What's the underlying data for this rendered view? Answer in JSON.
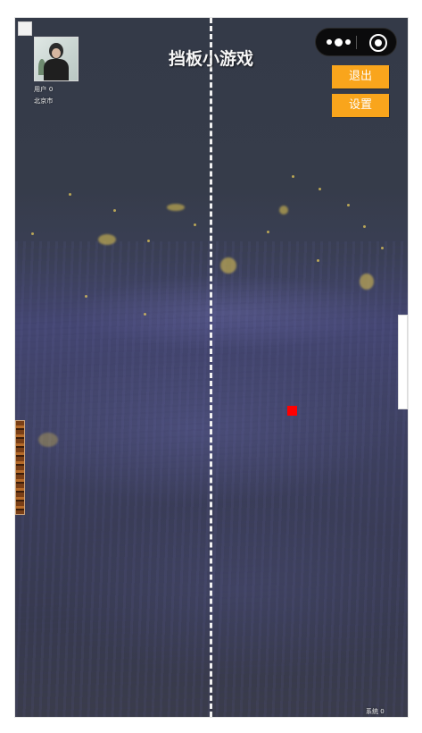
{
  "title": "挡板小游戏",
  "player": {
    "score_line": "用户 0",
    "location": "北京市"
  },
  "buttons": {
    "exit": "退出",
    "settings": "设置"
  },
  "system": {
    "score_line": "系统 0"
  },
  "colors": {
    "button_bg": "#f9a51c",
    "ball": "#ff0000",
    "net": "#f2f2f2"
  },
  "icons": {
    "capsule_menu": "more-dots-icon",
    "capsule_close": "target-circle-icon"
  }
}
